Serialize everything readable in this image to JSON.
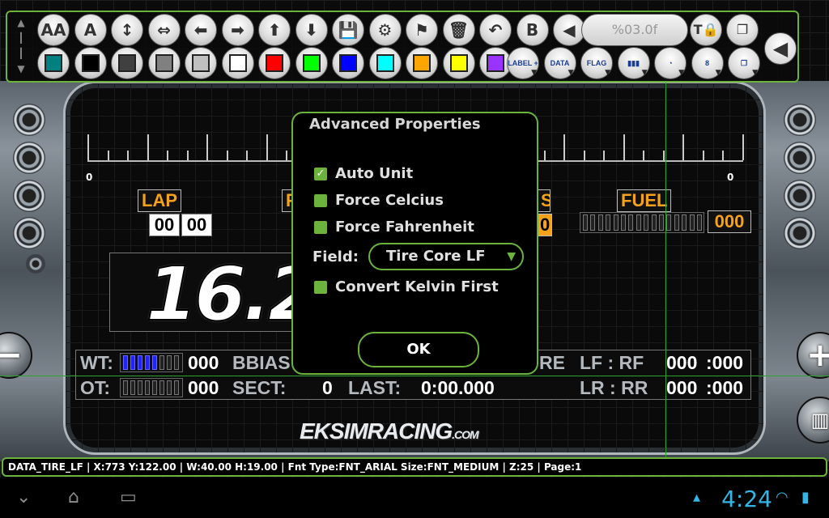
{
  "toolbar": {
    "row1": [
      {
        "name": "font-small-icon",
        "label": "AA"
      },
      {
        "name": "font-large-icon",
        "label": "A"
      },
      {
        "name": "resize-vertical-icon",
        "label": "↕"
      },
      {
        "name": "resize-horizontal-icon",
        "label": "⇔"
      },
      {
        "name": "arrow-left-icon",
        "label": "⬅"
      },
      {
        "name": "arrow-right-icon",
        "label": "➡"
      },
      {
        "name": "arrow-up-icon",
        "label": "⬆"
      },
      {
        "name": "arrow-down-icon",
        "label": "⬇"
      },
      {
        "name": "save-icon",
        "label": "💾"
      },
      {
        "name": "settings-gear-icon",
        "label": "⚙"
      },
      {
        "name": "flag-icon",
        "label": "⚑"
      },
      {
        "name": "trash-icon",
        "label": "🗑"
      },
      {
        "name": "undo-icon",
        "label": "↶"
      },
      {
        "name": "page-icon",
        "label": "B"
      },
      {
        "name": "rewind-icon",
        "label": "◀"
      }
    ],
    "format_value": "%03.0f",
    "row1_right": [
      {
        "name": "text-lock-icon",
        "label": "T🔒"
      },
      {
        "name": "layer-icon",
        "label": "❐"
      }
    ],
    "colors": [
      "#008080",
      "#000000",
      "#404040",
      "#808080",
      "#c0c0c0",
      "#ffffff",
      "#ff0000",
      "#00ff00",
      "#0000ff",
      "#00ffff",
      "#ffa500",
      "#ffff00",
      "#9933ff"
    ],
    "row2_right": [
      {
        "name": "label-add-icon",
        "label": "LABEL +"
      },
      {
        "name": "data-icon",
        "label": "DATA"
      },
      {
        "name": "flag-widget-icon",
        "label": "FLAG"
      },
      {
        "name": "bar-widget-icon",
        "label": "▮▮▮"
      },
      {
        "name": "gauge-widget-icon",
        "label": "◔"
      },
      {
        "name": "digit-widget-icon",
        "label": "8"
      },
      {
        "name": "duplicate-icon",
        "label": "❐"
      }
    ],
    "collapse_label": "◀"
  },
  "dashboard": {
    "scale_left": "0",
    "scale_right": "0",
    "lap_label": "LAP",
    "lap_values": [
      "00",
      "00"
    ],
    "pos_label": "P",
    "s_label": "S",
    "s_value": "0",
    "fuel_label": "FUEL",
    "fuel_value": "000",
    "speed": "16.2",
    "wt_label": "WT:",
    "wt_value": "000",
    "bbias_label": "BBIAS",
    "ot_label": "OT:",
    "ot_value": "000",
    "sect_label": "SECT:",
    "sect_value": "0",
    "last_label": "LAST:",
    "last_value": "0:00.000",
    "tire_label_partial": "RE",
    "lf_rf_label": "LF : RF",
    "lf_value": "000",
    "rf_value": ":000",
    "lr_rr_label": "LR : RR",
    "lr_value": "000",
    "rr_value": ":000",
    "logo": "EKSIMRACING",
    "logo_suffix": ".COM",
    "left_round_label": "−",
    "right_round_label": "+",
    "right_round2_label": "▥"
  },
  "dialog": {
    "title": "Advanced Properties",
    "options": [
      {
        "label": "Auto Unit",
        "checked": true
      },
      {
        "label": "Force Celcius",
        "checked": false
      },
      {
        "label": "Force Fahrenheit",
        "checked": false
      }
    ],
    "field_label": "Field:",
    "field_value": "Tire Core LF",
    "convert_label": "Convert Kelvin First",
    "convert_checked": false,
    "ok_label": "OK"
  },
  "status_bar": {
    "text": "DATA_TIRE_LF | X:773 Y:122.00 | W:40.00 H:19.00 | Fnt Type:FNT_ARIAL Size:FNT_MEDIUM | Z:25 | Page:1"
  },
  "system": {
    "time": "4:24",
    "back_icon": "back-icon",
    "home_icon": "home-icon",
    "recents_icon": "recents-icon"
  },
  "accent_color": "#6cb33e"
}
